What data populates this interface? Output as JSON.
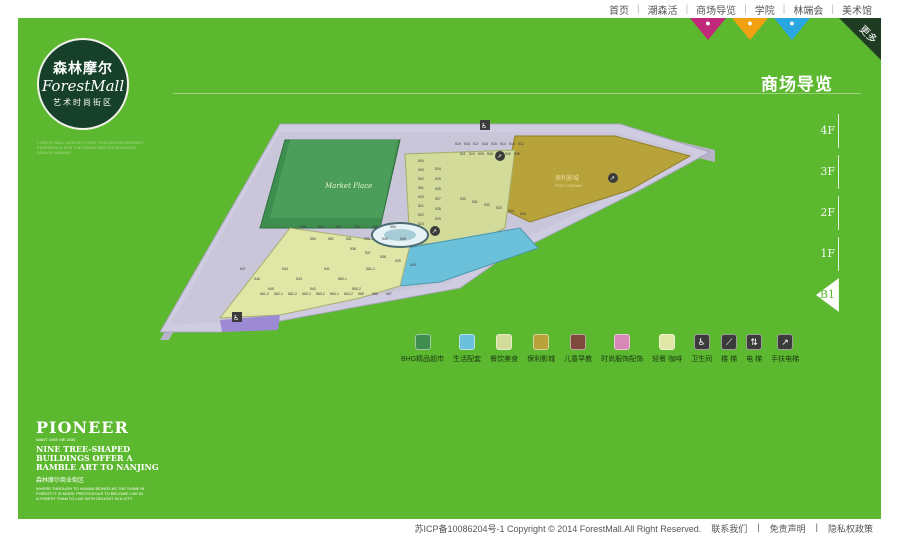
{
  "topnav": [
    "首页",
    "潮森活",
    "商场导览",
    "学院",
    "林端会",
    "美术馆"
  ],
  "brand": {
    "cn": "森林摩尔",
    "en": "ForestMall",
    "tagline": "艺术时尚街区",
    "note": "FOREST MALL WORLD'S FIRST TEAM ENTERTAINMENT EXPERIENCE FOR THE URBAN NATIVES BUSINESS AREA IN NANJING"
  },
  "flags": [
    {
      "icon": "weibo-icon",
      "color": "#c0287a"
    },
    {
      "icon": "weixin-icon",
      "color": "#f0a010"
    },
    {
      "icon": "tencent-icon",
      "color": "#2aa6e0"
    }
  ],
  "more_label": "更多",
  "page_title": "商场导览",
  "floors": [
    {
      "label": "4F",
      "active": false
    },
    {
      "label": "3F",
      "active": false
    },
    {
      "label": "2F",
      "active": false
    },
    {
      "label": "1F",
      "active": false
    },
    {
      "label": "B1",
      "active": true
    }
  ],
  "map": {
    "anchors": [
      "Market Place",
      "保利影城",
      "POLY CINEMA"
    ],
    "units": [
      "519",
      "518",
      "517",
      "516",
      "515",
      "514",
      "513",
      "512",
      "511",
      "510",
      "509",
      "508",
      "507",
      "506",
      "505",
      "504",
      "503",
      "502",
      "501",
      "520",
      "521",
      "522",
      "523",
      "524",
      "525",
      "526",
      "527",
      "528",
      "529",
      "530",
      "531",
      "532",
      "533",
      "534",
      "535",
      "536",
      "537",
      "538",
      "539",
      "540",
      "559",
      "558",
      "557",
      "556",
      "555",
      "554",
      "553",
      "552",
      "551",
      "550",
      "549",
      "548",
      "547",
      "546",
      "545",
      "544",
      "543",
      "542",
      "541",
      "560-1",
      "560-2",
      "561-1",
      "561-2",
      "562-1",
      "562-2",
      "563-1",
      "563-2",
      "564-1",
      "564-2",
      "565",
      "566",
      "567",
      "568",
      "558-1",
      "558-2",
      "558-3",
      "556-1",
      "556-2",
      "556-3"
    ]
  },
  "legend": [
    {
      "label": "BHG精品超市",
      "color": "#3e8f4f"
    },
    {
      "label": "生活配套",
      "color": "#6cc1da"
    },
    {
      "label": "餐饮美食",
      "color": "#d3db9a"
    },
    {
      "label": "保利影城",
      "color": "#b7a33a"
    },
    {
      "label": "儿童早教",
      "color": "#7f4a3c"
    },
    {
      "label": "时尚服饰配饰",
      "color": "#d689b4"
    },
    {
      "label": "轻餐 咖啡",
      "color": "#dfe6a6"
    },
    {
      "label": "卫生间",
      "icon": "restroom-icon"
    },
    {
      "label": "楼 梯",
      "icon": "stairs-icon"
    },
    {
      "label": "电 梯",
      "icon": "elevator-icon"
    },
    {
      "label": "手扶电梯",
      "icon": "escalator-icon"
    }
  ],
  "pioneer": {
    "title": "PIONEER",
    "sub": "WANT GIVE ME 2035",
    "headline": "NINE TREE-SHAPED BUILDINGS OFFER A RAMBLE ART TO NANJING",
    "cn": "森林摩尔商业街区",
    "body": "WHERE THROUGH TO HUMAN BEINGS AS THE SHINE IN FOREST IT IS MORE PRESTIGIOUS TO BECOME LIVE IN A FOREST THAN TO LIVE WITH DELIGHT IN A CITY"
  },
  "footer": {
    "copyright": "苏ICP备10086204号-1 Copyright © 2014 ForestMall.All Right Reserved.",
    "links": [
      "联系我们",
      "免责声明",
      "隐私权政策"
    ]
  }
}
